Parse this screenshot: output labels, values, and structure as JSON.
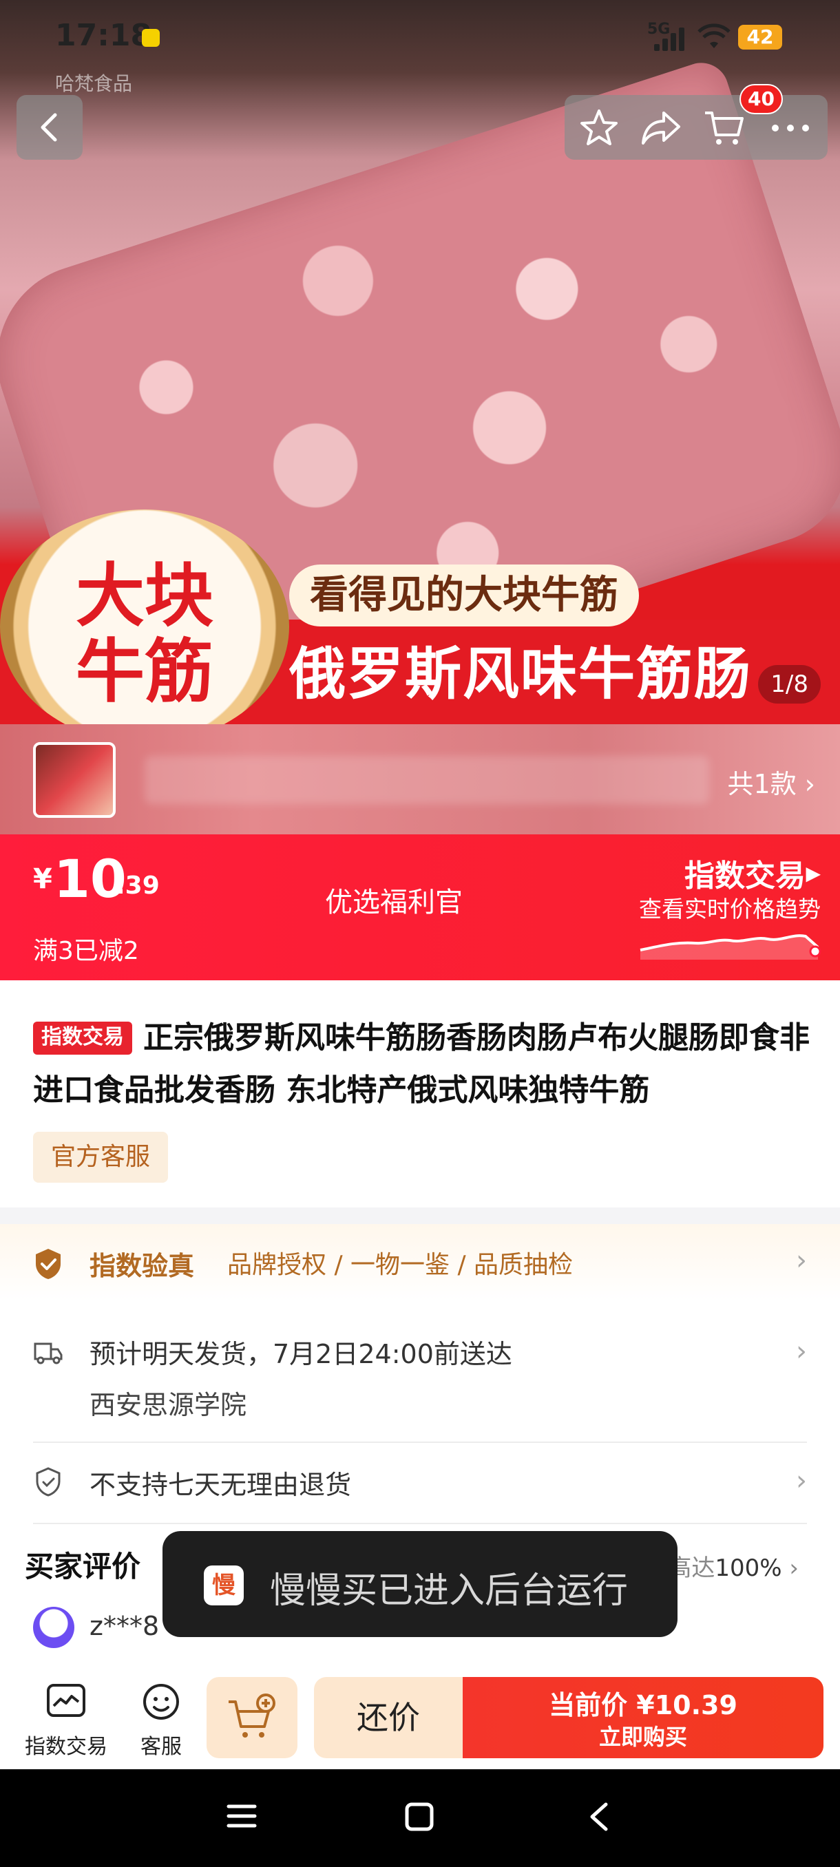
{
  "status_bar": {
    "time": "17:18",
    "network": "5G",
    "battery": "42"
  },
  "header": {
    "cart_count": "40"
  },
  "hero": {
    "brand": "哈梵食品",
    "badge_line1": "大块",
    "badge_line2": "牛筋",
    "sub_banner": "看得见的大块牛筋",
    "main_banner": "俄罗斯风味牛筋肠",
    "image_counter": "1/8"
  },
  "variants": {
    "count_label": "共1款"
  },
  "price": {
    "currency": "¥",
    "integer": "10",
    "decimal": ".39",
    "promo": "满3已减2",
    "official": "优选福利官",
    "index_link": "指数交易",
    "trend_hint": "查看实时价格趋势"
  },
  "product": {
    "tag": "指数交易",
    "title": "正宗俄罗斯风味牛筋肠香肠肉肠卢布火腿肠即食非进口食品批发香肠 东北特产俄式风味独特牛筋",
    "service_chip": "官方客服"
  },
  "verify": {
    "title": "指数验真",
    "items": "品牌授权 / 一物一鉴 / 品质抽检"
  },
  "shipping": {
    "line1": "预计明天发货，7月2日24:00前送达",
    "line2": "西安思源学院"
  },
  "returns": {
    "text": "不支持七天无理由退货"
  },
  "reviews": {
    "title": "买家评价",
    "praise_label": "好评率高达",
    "praise_value": "100%",
    "reviewer": "z***8"
  },
  "toast": {
    "icon_char": "慢",
    "text": "慢慢买已进入后台运行"
  },
  "bottom_bar": {
    "index_label": "指数交易",
    "service_label": "客服",
    "bargain_label": "还价",
    "buy_price": "当前价 ¥10.39",
    "buy_label": "立即购买"
  },
  "colors": {
    "accent_red": "#e8232e",
    "gold": "#b26a23"
  }
}
